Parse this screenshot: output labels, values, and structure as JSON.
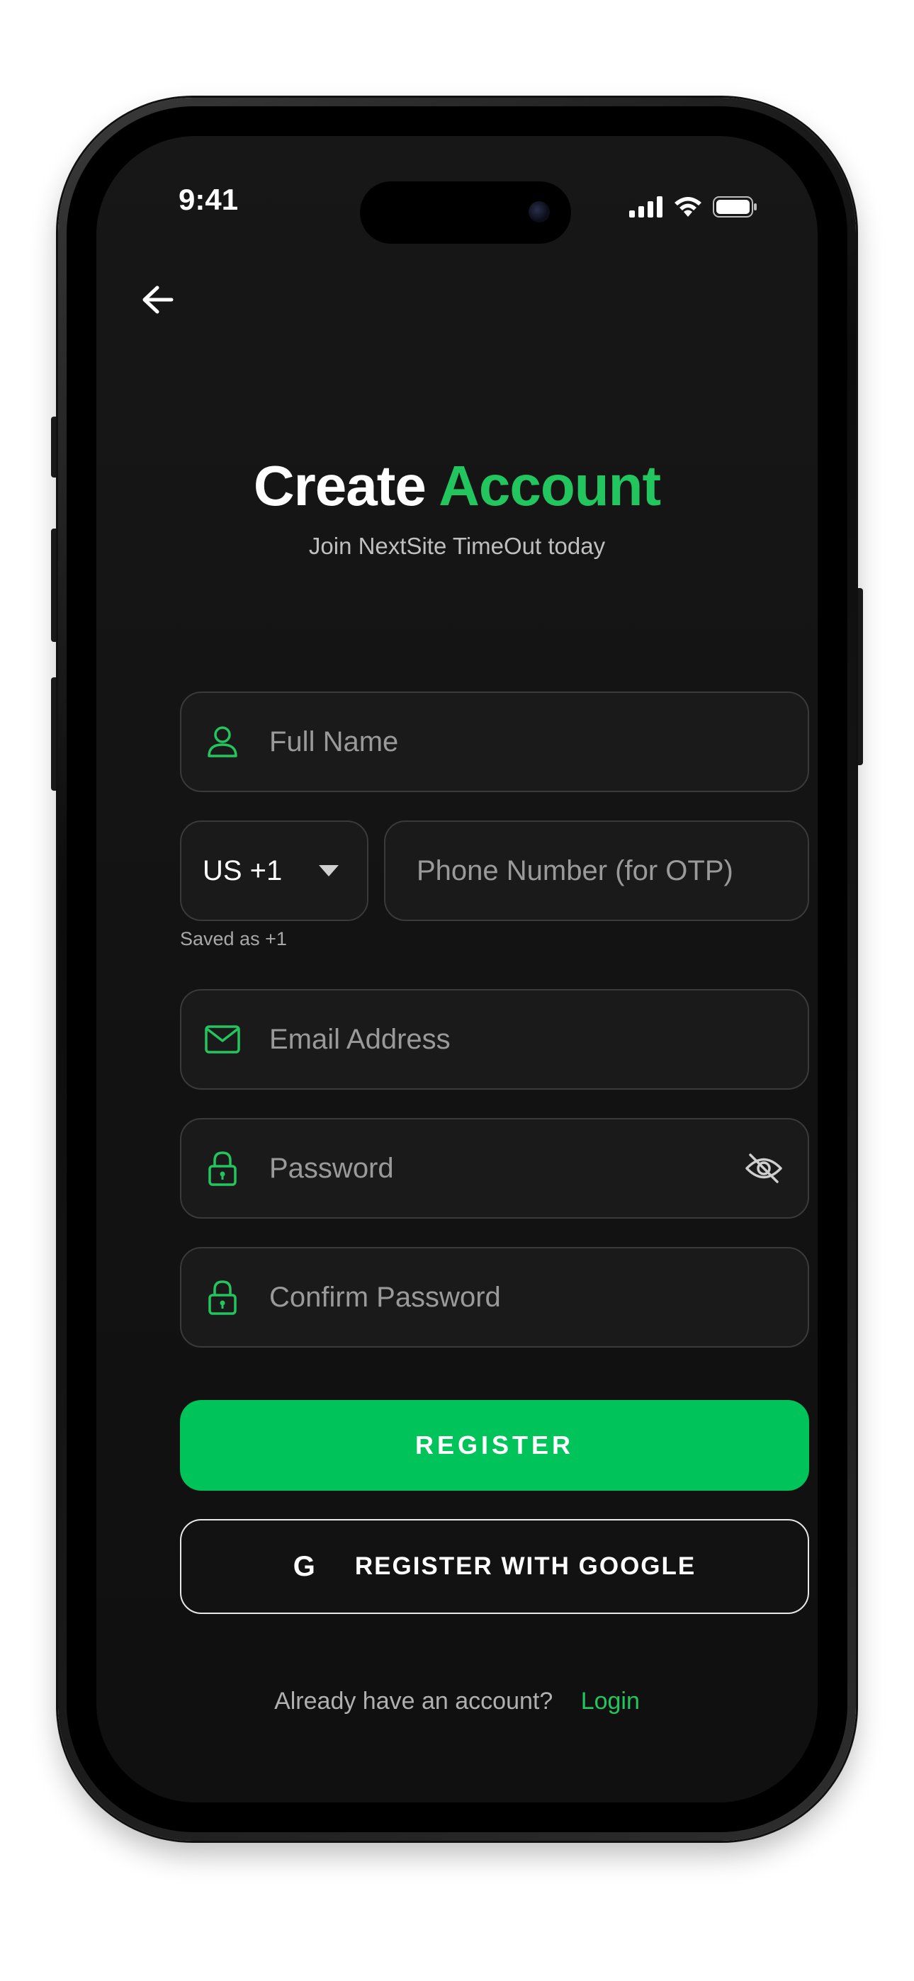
{
  "status_bar": {
    "time": "9:41",
    "icons": [
      "signal-icon",
      "wifi-icon",
      "battery-icon"
    ]
  },
  "header": {
    "back_icon": "arrow-left-icon",
    "title_part1": "Create",
    "title_part2": "Account",
    "subtitle": "Join NextSite TimeOut today"
  },
  "form": {
    "full_name": {
      "placeholder": "Full Name",
      "icon": "user-icon"
    },
    "country_code": {
      "value": "US +1",
      "icon": "caret-down-icon"
    },
    "phone": {
      "placeholder": "Phone Number (for OTP)"
    },
    "phone_helper": "Saved as +1",
    "email": {
      "placeholder": "Email Address",
      "icon": "mail-icon"
    },
    "password": {
      "placeholder": "Password",
      "icon": "lock-icon",
      "toggle_icon": "eye-off-icon"
    },
    "confirm_password": {
      "placeholder": "Confirm Password",
      "icon": "lock-icon"
    }
  },
  "actions": {
    "register_label": "REGISTER",
    "google_icon_letter": "G",
    "google_label": "REGISTER WITH GOOGLE"
  },
  "footer": {
    "prompt": "Already have an account?",
    "login_label": "Login"
  },
  "colors": {
    "accent": "#22c55e",
    "primary_button": "#00c45a",
    "background": "#141414",
    "field_border": "#3a3a3a"
  }
}
